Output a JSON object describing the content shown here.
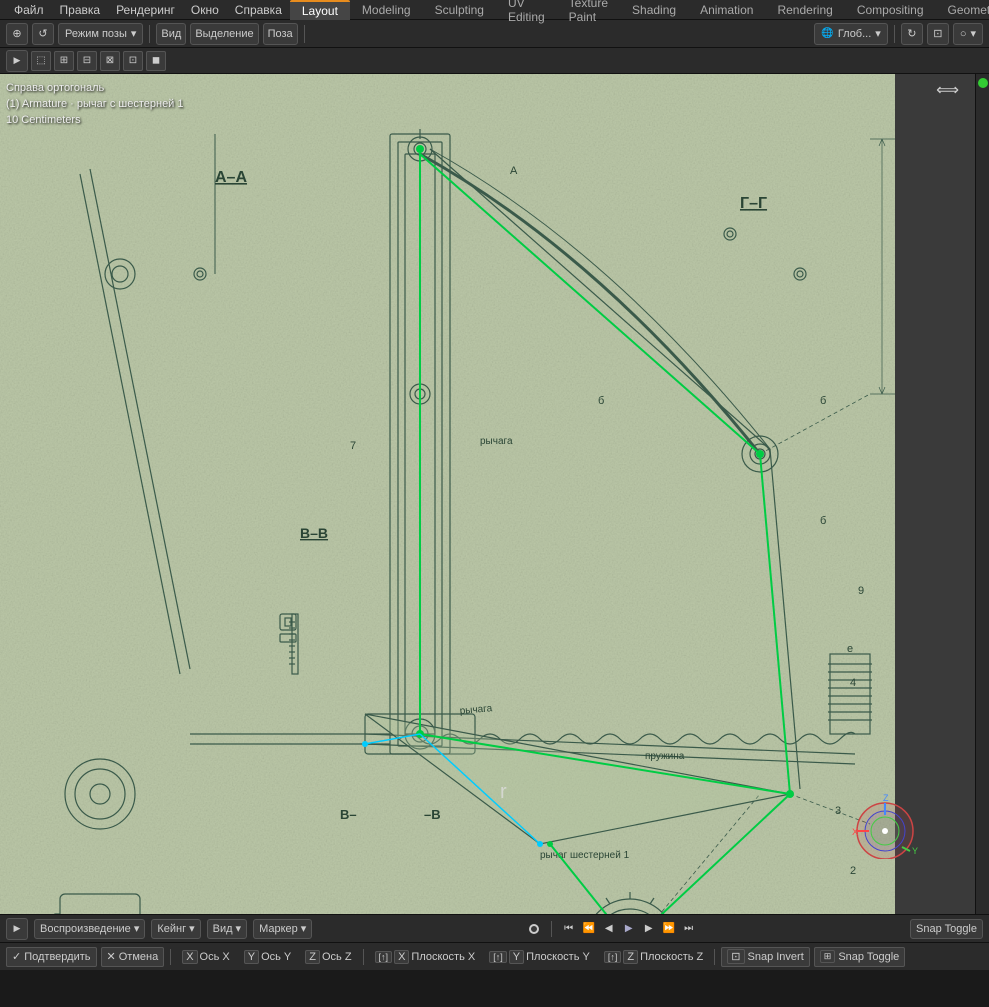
{
  "topMenu": {
    "items": [
      {
        "label": "Файл",
        "id": "file"
      },
      {
        "label": "Правка",
        "id": "edit"
      },
      {
        "label": "Рендеринг",
        "id": "render"
      },
      {
        "label": "Окно",
        "id": "window"
      },
      {
        "label": "Справка",
        "id": "help"
      }
    ]
  },
  "workspaceTabs": [
    {
      "label": "Layout",
      "active": true
    },
    {
      "label": "Modeling",
      "active": false
    },
    {
      "label": "Sculpting",
      "active": false
    },
    {
      "label": "UV Editing",
      "active": false
    },
    {
      "label": "Texture Paint",
      "active": false
    },
    {
      "label": "Shading",
      "active": false
    },
    {
      "label": "Animation",
      "active": false
    },
    {
      "label": "Rendering",
      "active": false
    },
    {
      "label": "Compositing",
      "active": false
    },
    {
      "label": "Geometry…",
      "active": false
    }
  ],
  "toolbar": {
    "poseMode": "Режим позы",
    "viewLabel": "Вид",
    "selectionLabel": "Выделение",
    "poseLabel": "Поза",
    "globalLabel": "Глоб...",
    "dropdownArrow": "▾"
  },
  "viewport": {
    "info": {
      "title": "Справа ортогональ",
      "line2": "(1) Armature · рычаг с шестерней 1",
      "line3": "10 Centimeters"
    }
  },
  "timeline": {
    "playbackLabel": "Воспроизведение",
    "keyingLabel": "Кейнг",
    "viewLabel": "Вид",
    "markerLabel": "Маркер"
  },
  "statusBar": {
    "confirmLabel": "Подтвердить",
    "cancelLabel": "Отмена",
    "axisX": "Ось X",
    "axisY": "Ось Y",
    "axisZ": "Ось Z",
    "planeX": "Плоскость X",
    "planeY": "Плоскость Y",
    "planeZ": "Плоскость Z",
    "snapInvert": "Snap Invert",
    "snapToggle": "Snap Toggle",
    "letters": {
      "x": "X",
      "y": "Y",
      "z": "Z",
      "shiftX": "[↑]",
      "shiftY": "[↑]",
      "shiftZ": "[↑]"
    }
  },
  "icons": {
    "chevronRight": "▶",
    "chevronLeft": "◀",
    "chevronDown": "▾",
    "chevronUp": "▴",
    "arrow": "→",
    "dot": "●",
    "square": "■",
    "plus": "+",
    "close": "✕",
    "gear": "⚙",
    "move": "⊕",
    "rotate": "↻",
    "scale": "⤡",
    "cursor": "⊕"
  }
}
